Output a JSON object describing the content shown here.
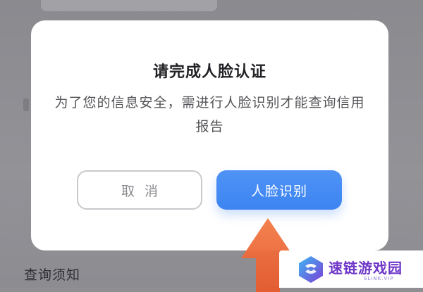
{
  "dialog": {
    "title": "请完成人脸认证",
    "message": "为了您的信息安全，需进行人脸识别才能查询信用报告",
    "cancel_label": "取消",
    "confirm_label": "人脸识别"
  },
  "background": {
    "section_title": "查询须知"
  },
  "watermark": {
    "name": "速链游戏园",
    "sub": "SLINK.VIP"
  },
  "colors": {
    "accent": "#3d84f2",
    "arrow": "#f06a3b",
    "watermark": "#6e36c8"
  },
  "icons": {
    "pointer": "red-arrow-icon",
    "logo": "slink-logo-icon"
  }
}
